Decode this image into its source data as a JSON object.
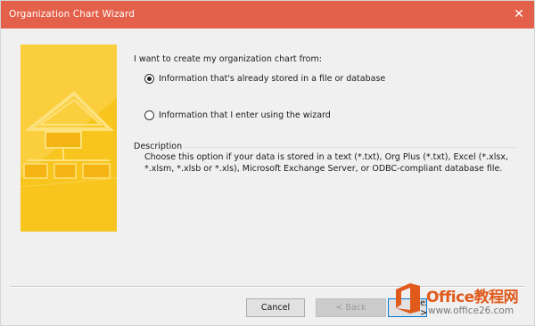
{
  "window": {
    "title": "Organization Chart Wizard",
    "close_glyph": "✕"
  },
  "colors": {
    "titlebar": "#e3604a",
    "graphic_yellow": "#f7c51e",
    "graphic_light": "#fde17c",
    "watermark_orange": "#e05a1c"
  },
  "content": {
    "prompt": "I want to create my organization chart from:",
    "options": [
      {
        "label": "Information that's already stored in a file or database",
        "selected": true
      },
      {
        "label": "Information that I enter using the wizard",
        "selected": false
      }
    ],
    "description_heading": "Description",
    "description_text": "Choose this option if your data is stored in a text (*.txt), Org Plus (*.txt), Excel (*.xlsx, *.xlsm, *.xlsb or *.xls), Microsoft Exchange Server, or ODBC-compliant database file."
  },
  "buttons": {
    "cancel": "Cancel",
    "back": "< Back",
    "next": "Next >"
  },
  "watermark": {
    "title": "Office教程网",
    "url": "www.office26.com",
    "logo_icon": "office-logo-icon"
  }
}
